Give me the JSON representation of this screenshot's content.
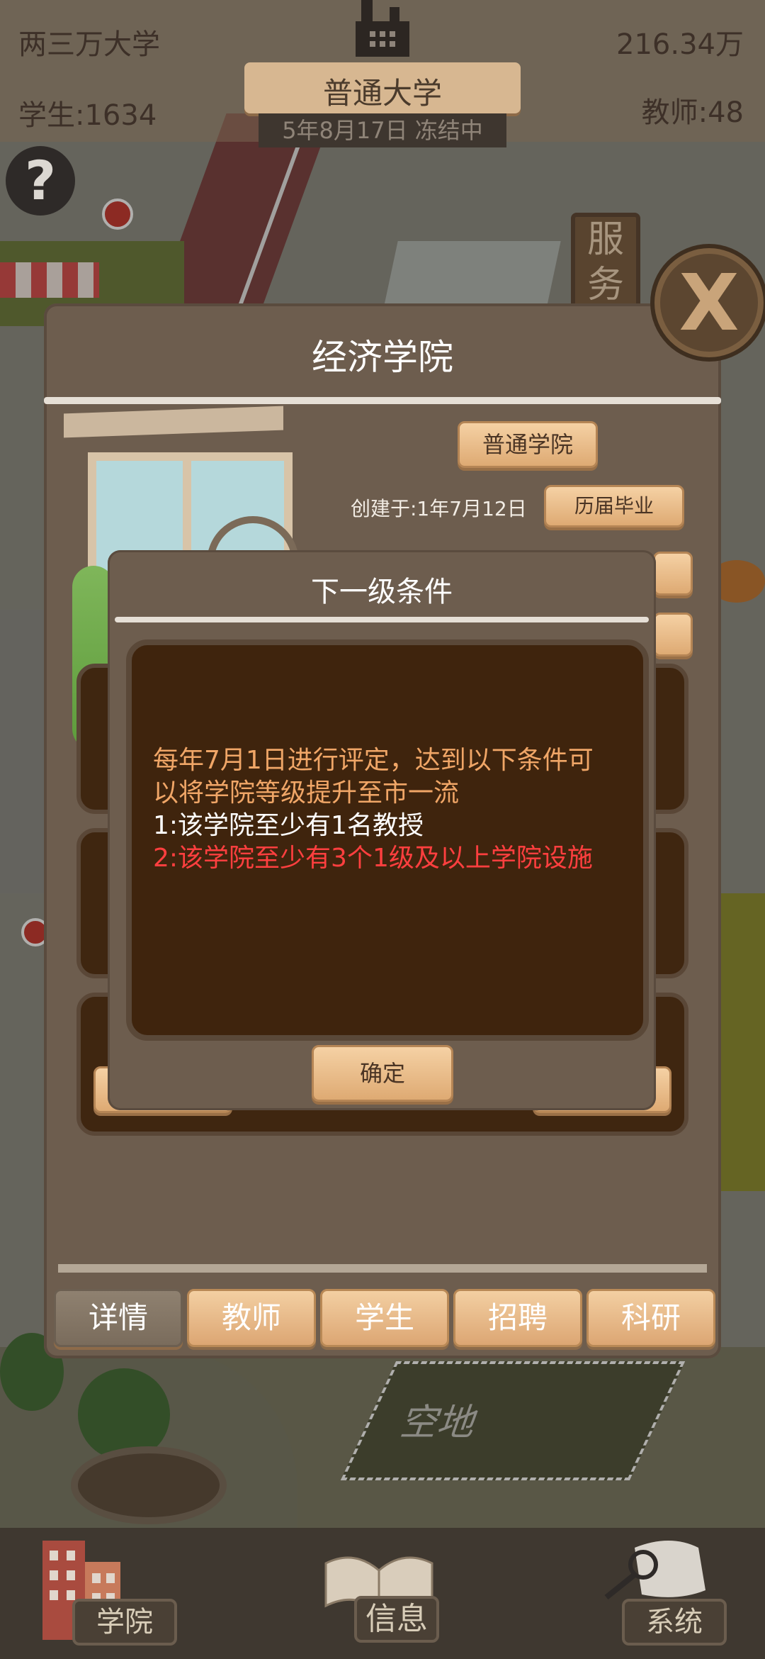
{
  "hud": {
    "university_name": "两三万大学",
    "money": "216.34万",
    "students": "学生:1634",
    "teachers": "教师:48",
    "rank": "普通大学",
    "date_status": "5年8月17日 冻结中",
    "help_glyph": "?"
  },
  "scene": {
    "service_sign": "服务",
    "vacant_lot_label": "空地"
  },
  "college_panel": {
    "title": "经济学院",
    "level_badge": "普通学院",
    "founded": "创建于:1年7月12日",
    "graduates_button": "历届毕业",
    "tabs": [
      "详情",
      "教师",
      "学生",
      "招聘",
      "科研"
    ],
    "close_glyph": "X"
  },
  "modal": {
    "title": "下一级条件",
    "line1": "每年7月1日进行评定，达到以下条件可以将学院等级提升至市一流",
    "condition1": "1:该学院至少有1名教授",
    "condition2": "2:该学院至少有3个1级及以上学院设施",
    "confirm_button": "确定"
  },
  "bottom_nav": {
    "college": "学院",
    "info": "信息",
    "system": "系统"
  },
  "colors": {
    "panel": "#6d5d4e",
    "button": "#deaa73",
    "text_orange": "#f0a667",
    "text_red": "#ff3f3f",
    "dark_box": "#3f240d"
  }
}
